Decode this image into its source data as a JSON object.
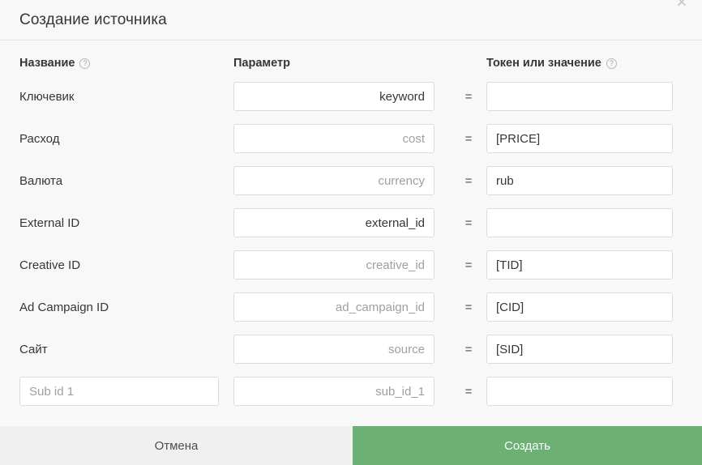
{
  "dialog": {
    "title": "Создание источника",
    "close_label": "×"
  },
  "columns": {
    "name": "Название",
    "param": "Параметр",
    "token": "Токен или значение",
    "help_glyph": "?",
    "equals": "="
  },
  "rows": [
    {
      "label": "Ключевик",
      "param_value": "keyword",
      "param_placeholder": "",
      "token_value": "",
      "token_placeholder": ""
    },
    {
      "label": "Расход",
      "param_value": "",
      "param_placeholder": "cost",
      "token_value": "[PRICE]",
      "token_placeholder": ""
    },
    {
      "label": "Валюта",
      "param_value": "",
      "param_placeholder": "currency",
      "token_value": "rub",
      "token_placeholder": ""
    },
    {
      "label": "External ID",
      "param_value": "external_id",
      "param_placeholder": "",
      "token_value": "",
      "token_placeholder": ""
    },
    {
      "label": "Creative ID",
      "param_value": "",
      "param_placeholder": "creative_id",
      "token_value": "[TID]",
      "token_placeholder": ""
    },
    {
      "label": "Ad Campaign ID",
      "param_value": "",
      "param_placeholder": "ad_campaign_id",
      "token_value": "[CID]",
      "token_placeholder": ""
    },
    {
      "label": "Сайт",
      "param_value": "",
      "param_placeholder": "source",
      "token_value": "[SID]",
      "token_placeholder": ""
    }
  ],
  "custom_row": {
    "name_value": "",
    "name_placeholder": "Sub id 1",
    "param_value": "",
    "param_placeholder": "sub_id_1",
    "token_value": "",
    "token_placeholder": ""
  },
  "footer": {
    "cancel_label": "Отмена",
    "create_label": "Создать"
  },
  "colors": {
    "accent_green": "#6cb073",
    "background": "#f8f8f9",
    "field_border": "#dcdcdf",
    "text": "#33373b",
    "placeholder": "#9ea0a4"
  }
}
